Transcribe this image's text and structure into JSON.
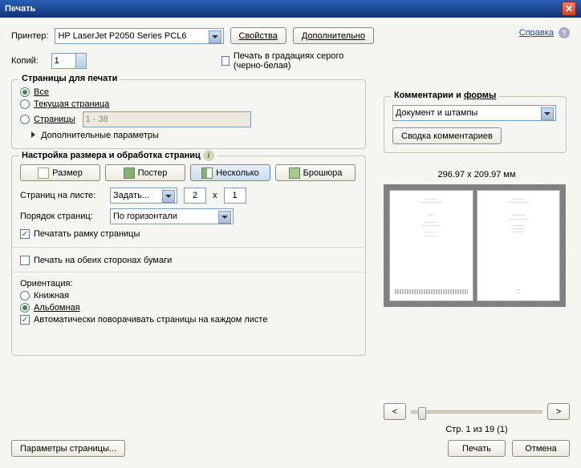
{
  "title": "Печать",
  "help_link": "Справка",
  "printer": {
    "label": "Принтер:",
    "value": "HP LaserJet P2050 Series PCL6",
    "properties_btn": "Свойства",
    "advanced_btn": "Дополнительно"
  },
  "copies": {
    "label": "Копий:",
    "value": "1"
  },
  "grayscale_check": "Печать в градациях серого (черно-белая)",
  "pages": {
    "legend": "Страницы для печати",
    "all": "Все",
    "current": "Текущая страница",
    "range_label": "Страницы",
    "range_value": "1 - 38",
    "more_params": "Дополнительные параметры"
  },
  "sizing": {
    "legend": "Настройка размера и обработка страниц",
    "size_btn": "Размер",
    "poster_btn": "Постер",
    "multiple_btn": "Несколько",
    "booklet_btn": "Брошюра",
    "per_sheet_label": "Страниц на листе:",
    "per_sheet_value": "Задать...",
    "cols": "2",
    "times": "x",
    "rows": "1",
    "order_label": "Порядок страниц:",
    "order_value": "По горизонтали",
    "border_check": "Печатать рамку страницы",
    "duplex_check": "Печать на обеих сторонах бумаги",
    "orientation_label": "Ориентация:",
    "portrait": "Книжная",
    "landscape": "Альбомная",
    "autorotate": "Автоматически поворачивать страницы на каждом листе"
  },
  "comments": {
    "legend_a": "Комментарии и ",
    "legend_b": "формы",
    "combo": "Документ и штампы",
    "summary_btn": "Сводка комментариев"
  },
  "preview": {
    "dims": "296.97 x 209.97 мм",
    "prev": "<",
    "next": ">",
    "status": "Стр. 1 из 19 (1)"
  },
  "footer": {
    "page_setup": "Параметры страницы...",
    "print": "Печать",
    "cancel": "Отмена"
  }
}
